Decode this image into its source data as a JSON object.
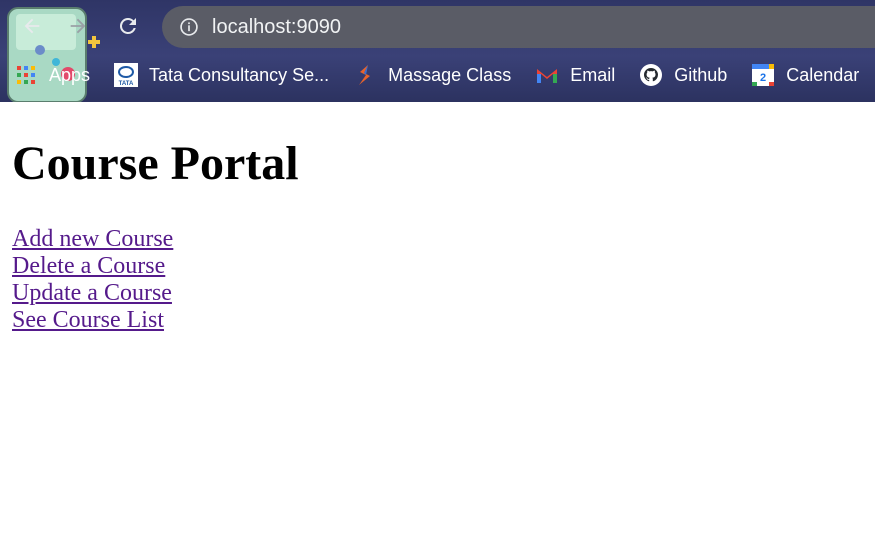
{
  "browser": {
    "url": "localhost:9090",
    "bookmarks": [
      {
        "label": "Apps",
        "icon": "apps-grid-icon"
      },
      {
        "label": "Tata Consultancy Se...",
        "icon": "tata-logo-icon"
      },
      {
        "label": "Massage Class",
        "icon": "massage-class-icon"
      },
      {
        "label": "Email",
        "icon": "gmail-icon"
      },
      {
        "label": "Github",
        "icon": "github-icon"
      },
      {
        "label": "Calendar",
        "icon": "calendar-icon"
      }
    ],
    "calendar_icon_day": "2",
    "tata_icon_text": "TATA"
  },
  "page": {
    "title": "Course Portal",
    "links": [
      "Add new Course",
      "Delete a Course",
      "Update a Course",
      "See Course List"
    ]
  },
  "colors": {
    "visited_link": "#551a8b",
    "chrome_bg": "#343a6e",
    "omnibox_bg": "#5a5c66"
  }
}
